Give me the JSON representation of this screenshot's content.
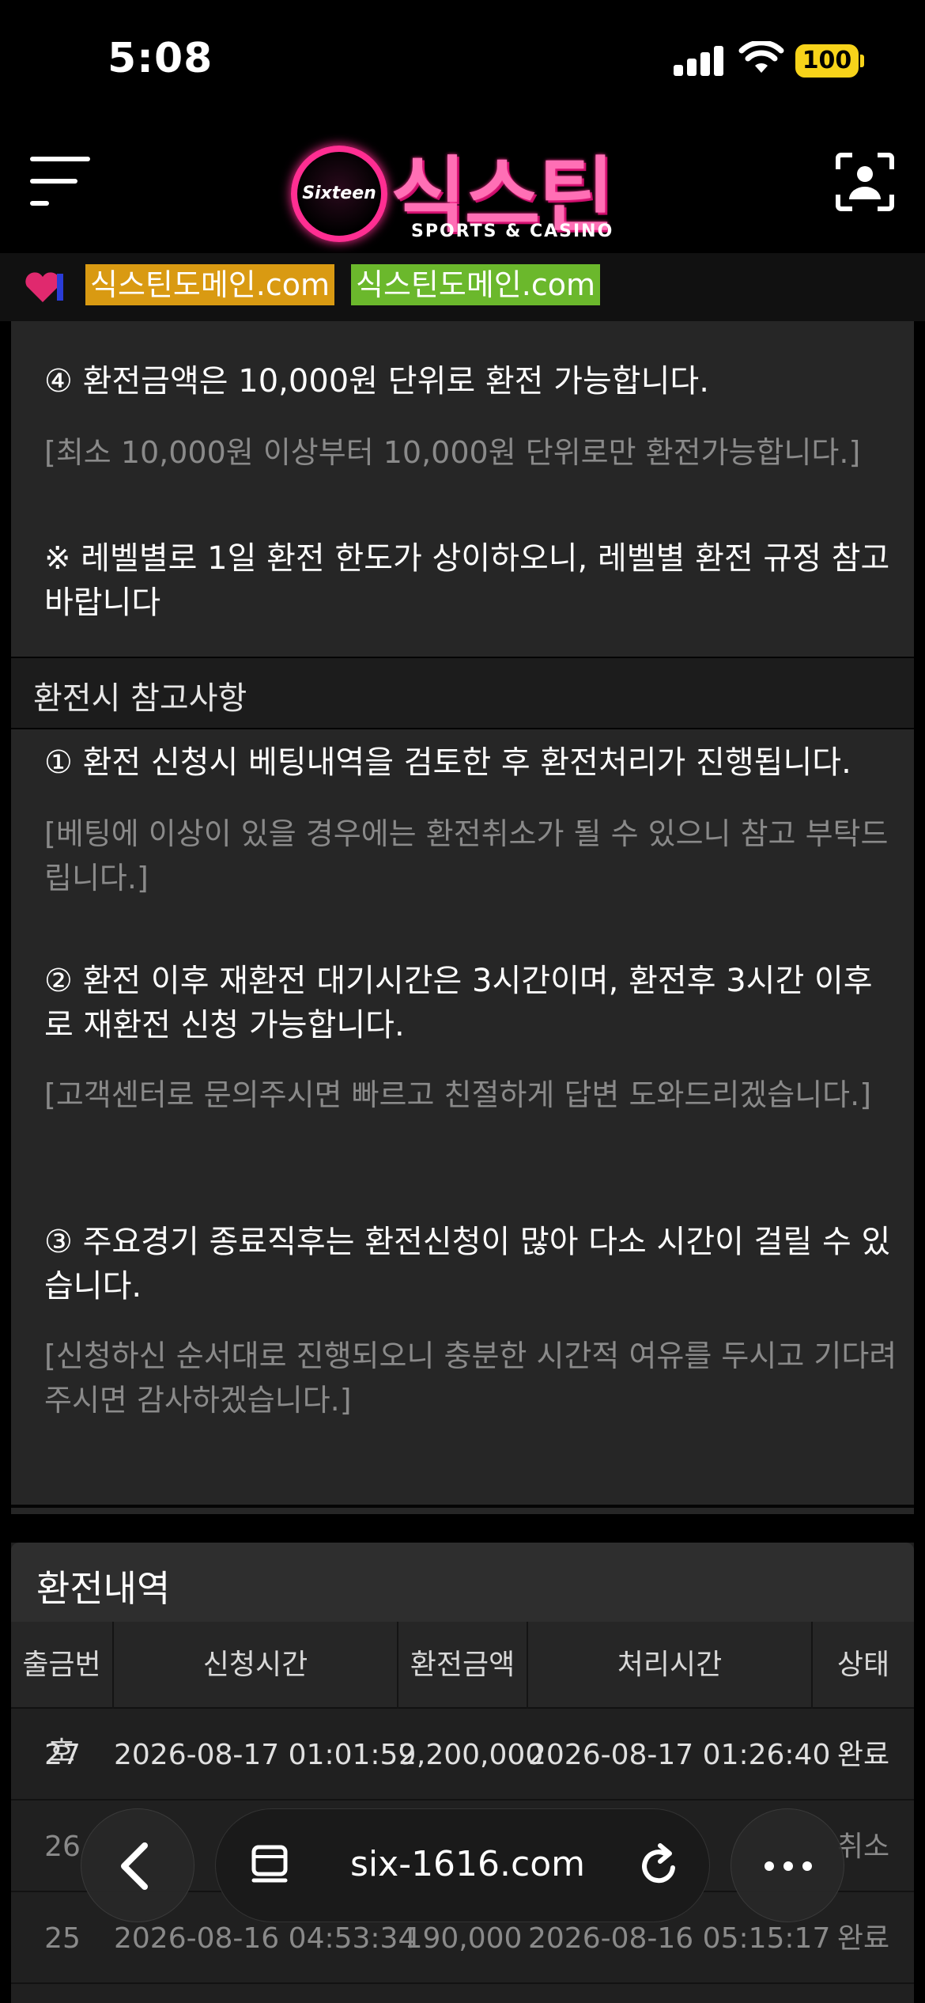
{
  "status_bar": {
    "time": "5:08",
    "battery": "100"
  },
  "header": {
    "logo_badge": "Sixteen",
    "logo_title": "식스틴",
    "logo_subtitle": "SPORTS & CASINO"
  },
  "domain_strip": {
    "domains": [
      "식스틴도메인.com",
      "식스틴도메인.com"
    ],
    "colors": [
      "#d99a12",
      "#6bb82c"
    ]
  },
  "rules": {
    "item4_title": "④ 환전금액은 10,000원 단위로 환전 가능합니다.",
    "item4_note": "[최소 10,000원 이상부터 10,000원 단위로만 환전가능합니다.]",
    "level_note": "※ 레벨별로 1일 환전 한도가 상이하오니, 레벨별 환전 규정 참고바랍니다"
  },
  "notes_section": {
    "heading": "환전시 참고사항",
    "items": [
      {
        "title": "① 환전 신청시 베팅내역을 검토한 후 환전처리가 진행됩니다.",
        "note": "[베팅에 이상이 있을 경우에는 환전취소가 될 수 있으니 참고 부탁드립니다.]"
      },
      {
        "title": "② 환전 이후 재환전 대기시간은 3시간이며, 환전후 3시간 이후로 재환전 신청 가능합니다.",
        "note": "[고객센터로 문의주시면 빠르고 친절하게 답변 도와드리겠습니다.]"
      },
      {
        "title": "③ 주요경기 종료직후는 환전신청이 많아 다소 시간이 걸릴 수 있습니다.",
        "note": "[신청하신 순서대로 진행되오니 충분한 시간적 여유를 두시고 기다려 주시면 감사하겠습니다.]"
      }
    ]
  },
  "history": {
    "title": "환전내역",
    "columns": [
      "출금번호",
      "신청시간",
      "환전금액",
      "처리시간",
      "상태"
    ],
    "rows": [
      {
        "no": "27",
        "requested": "2026-08-17 01:01:59",
        "amount": "2,200,000",
        "processed": "2026-08-17 01:26:40",
        "status": "완료"
      },
      {
        "no": "26",
        "requested": "",
        "amount": "",
        "processed": "",
        "status": "취소"
      },
      {
        "no": "25",
        "requested": "2026-08-16 04:53:34",
        "amount": "190,000",
        "processed": "2026-08-16 05:15:17",
        "status": "완료"
      }
    ]
  },
  "browser": {
    "url": "six-1616.com"
  }
}
